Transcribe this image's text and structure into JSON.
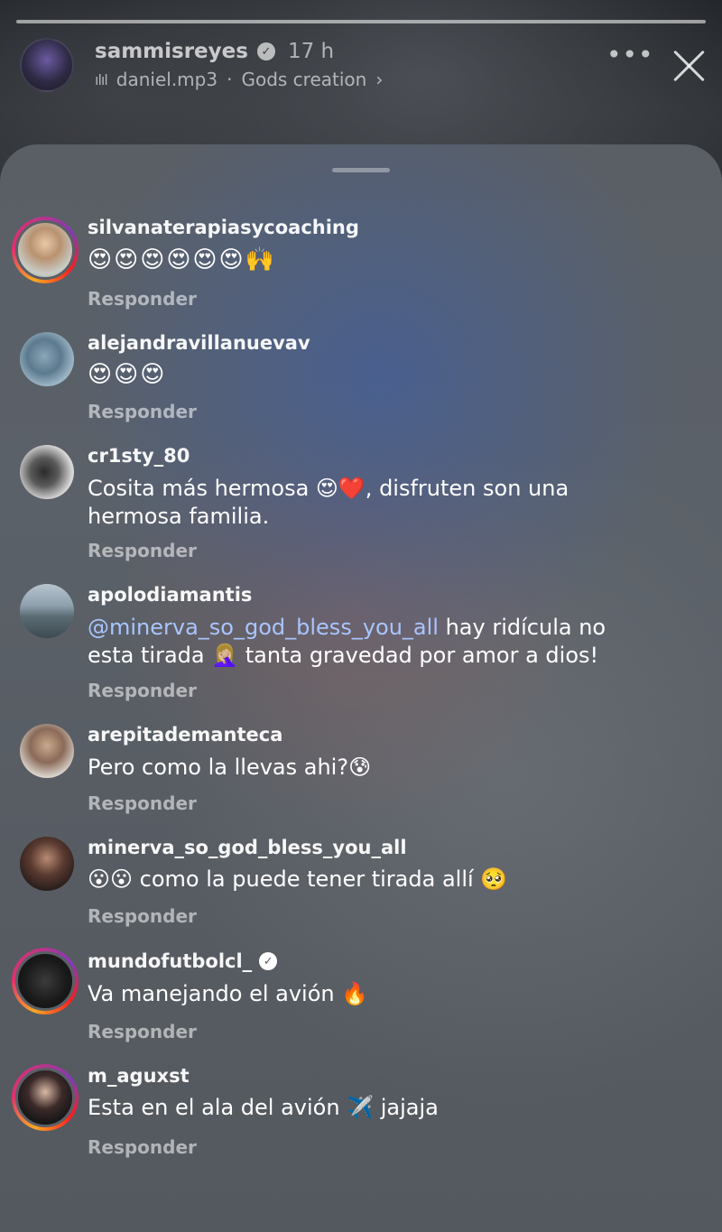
{
  "story": {
    "username": "sammisreyes",
    "time": "17 h",
    "music_track": "daniel.mp3",
    "music_artist": "Gods creation",
    "music_separator": "·",
    "chevron": "›",
    "more": "•••"
  },
  "reply_label": "Responder",
  "comments": [
    {
      "username": "silvanaterapiasycoaching",
      "text": "😍😍😍😍😍😍🙌",
      "verified": false
    },
    {
      "username": "alejandravillanuevav",
      "text": "😍😍😍",
      "verified": false
    },
    {
      "username": "cr1sty_80",
      "text": "Cosita más hermosa 😍❤️, disfruten son una hermosa familia.",
      "verified": false
    },
    {
      "username": "apolodiamantis",
      "mention": "@minerva_so_god_bless_you_all",
      "text": " hay ridícula no esta tirada 🤦🏼‍♀️ tanta gravedad por amor a dios!",
      "verified": false
    },
    {
      "username": "arepitademanteca",
      "text": "Pero como la llevas ahi?😰",
      "verified": false
    },
    {
      "username": "minerva_so_god_bless_you_all",
      "text": "😮😮 como la puede tener tirada allí 🥺",
      "verified": false
    },
    {
      "username": "mundofutbolcl_",
      "text": "Va manejando el avión 🔥",
      "verified": true
    },
    {
      "username": "m_aguxst",
      "text": "Esta en el ala del avión ✈️ jajaja",
      "verified": false
    }
  ]
}
